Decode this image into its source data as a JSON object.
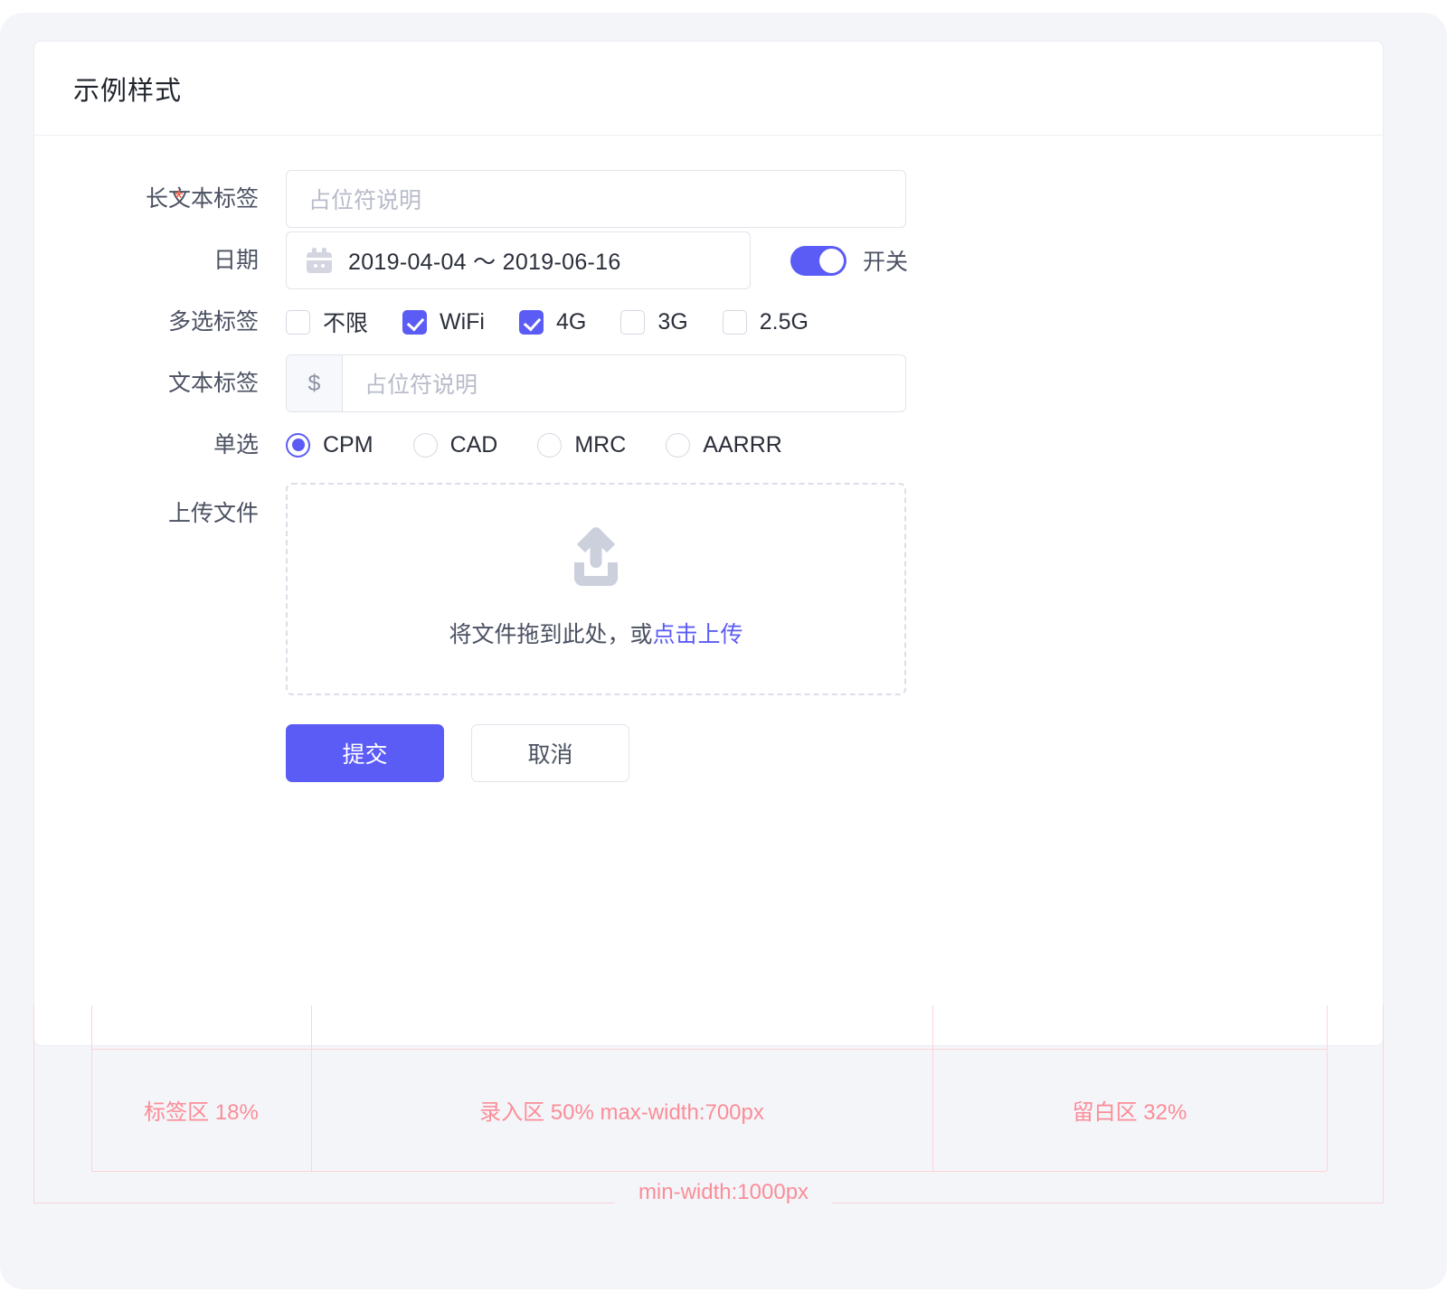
{
  "card": {
    "title": "示例样式"
  },
  "form": {
    "rows": [
      {
        "label": "长文本标签",
        "required": true,
        "required_mark": "*",
        "type": "text",
        "placeholder": "占位符说明",
        "value": ""
      },
      {
        "label": "日期",
        "required": false,
        "type": "daterange",
        "icon": "calendar-icon",
        "value": "2019-04-04 ～ 2019-06-16",
        "switch": {
          "label": "开关",
          "on": true
        }
      },
      {
        "label": "多选标签",
        "required": false,
        "type": "checkbox",
        "options": [
          {
            "label": "不限",
            "checked": false
          },
          {
            "label": "WiFi",
            "checked": true
          },
          {
            "label": "4G",
            "checked": true
          },
          {
            "label": "3G",
            "checked": false
          },
          {
            "label": "2.5G",
            "checked": false
          }
        ]
      },
      {
        "label": "文本标签",
        "required": false,
        "type": "text-addon",
        "addon": "$",
        "placeholder": "占位符说明",
        "value": ""
      },
      {
        "label": "单选",
        "required": false,
        "type": "radio",
        "options": [
          {
            "label": "CPM",
            "selected": true
          },
          {
            "label": "CAD",
            "selected": false
          },
          {
            "label": "MRC",
            "selected": false
          },
          {
            "label": "AARRR",
            "selected": false
          }
        ]
      },
      {
        "label": "上传文件",
        "required": false,
        "type": "upload",
        "icon": "upload-icon",
        "hint_prefix": "将文件拖到此处，或",
        "hint_link": "点击上传"
      }
    ],
    "actions": {
      "submit": "提交",
      "cancel": "取消"
    }
  },
  "annotations": {
    "label_area": "标签区 18%",
    "input_area": "录入区 50% max-width:700px",
    "blank_area": "留白区 32%",
    "min_width": "min-width:1000px"
  },
  "colors": {
    "primary": "#5b5bf6",
    "required": "#f5573c",
    "annotation": "#fb8d98",
    "annotation_line": "#fbd4d6",
    "page_bg": "#f4f5f9",
    "text": "#2b2f3a",
    "placeholder": "#b8bcc9"
  }
}
